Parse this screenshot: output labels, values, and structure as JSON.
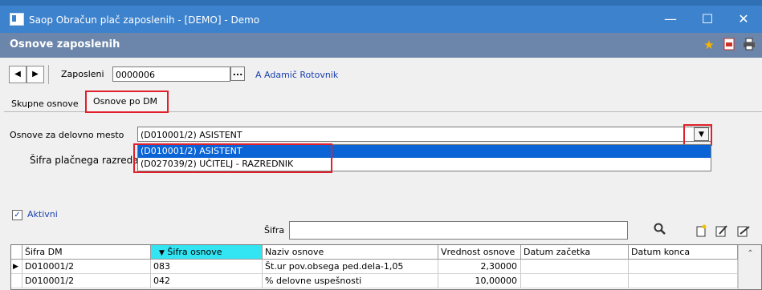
{
  "window": {
    "title": "Saop Obračun plač zaposlenih - [DEMO] - Demo",
    "minimize": "—",
    "maximize": "☐",
    "close": "✕"
  },
  "module": {
    "title": "Osnove zaposlenih"
  },
  "employee": {
    "label": "Zaposleni",
    "code": "0000006",
    "browse": "...",
    "name": "A Adamič Rotovnik",
    "prev": "◀",
    "next": "▶"
  },
  "tabs": [
    {
      "label": "Skupne osnove"
    },
    {
      "label": "Osnove po DM"
    }
  ],
  "workplace": {
    "label": "Osnove  za delovno mesto",
    "selected": "(D010001/2) ASISTENT",
    "dropdown_arrow": "▼",
    "options": [
      "(D010001/2) ASISTENT",
      "(D027039/2) UČITELJ - RAZREDNIK"
    ]
  },
  "pay_grade_label": "Šifra plačnega razreda",
  "active": {
    "label": "Aktivni",
    "checked": true,
    "check": "✓"
  },
  "search": {
    "label": "Šifra",
    "value": ""
  },
  "grid": {
    "columns": [
      "Šifra DM",
      "Šifra osnove",
      "Naziv osnove",
      "Vrednost osnove",
      "Datum začetka",
      "Datum konca"
    ],
    "sort_marker": "▼",
    "rows": [
      {
        "dm": "D010001/2",
        "code": "083",
        "name": "Št.ur pov.obsega ped.dela-1,05",
        "value": "2,30000",
        "start": "",
        "end": ""
      },
      {
        "dm": "D010001/2",
        "code": "042",
        "name": "% delovne uspešnosti",
        "value": "10,00000",
        "start": "",
        "end": ""
      }
    ]
  },
  "colors": {
    "titlebar": "#3d82cc",
    "header": "#6b86aa",
    "accent_red": "#e0202a",
    "selected_option": "#0a64d6",
    "sorted_header": "#33e4f2"
  }
}
